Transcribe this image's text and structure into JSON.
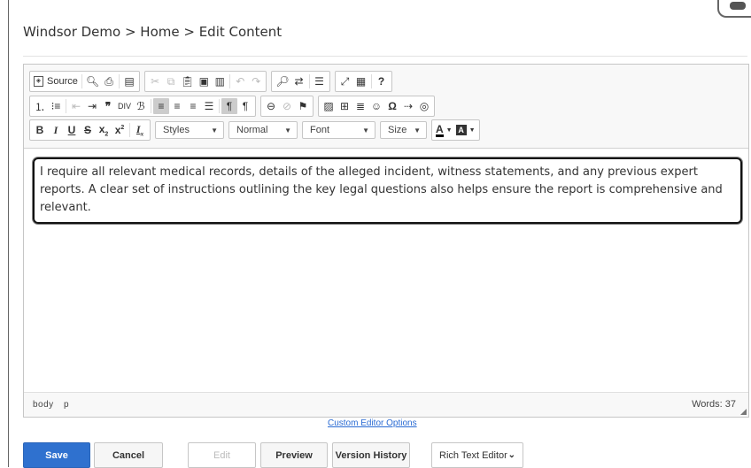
{
  "breadcrumb": "Windsor Demo > Home > Edit Content",
  "toolbar": {
    "row1": {
      "source_label": "Source",
      "icons": [
        "preview-icon",
        "print-icon",
        "templates-icon",
        "cut-icon",
        "copy-icon",
        "paste-icon",
        "paste-text-icon",
        "paste-word-icon",
        "undo-icon",
        "redo-icon",
        "find-icon",
        "replace-icon",
        "select-all-icon",
        "maximize-icon",
        "show-blocks-icon",
        "help-icon"
      ]
    },
    "row3": {
      "styles": "Styles",
      "format": "Normal",
      "font": "Font",
      "size": "Size"
    }
  },
  "content": {
    "paragraph": "I require all relevant medical records, details of the alleged incident, witness statements, and any previous expert reports. A clear set of instructions outlining the key legal questions also helps ensure the report is comprehensive and relevant."
  },
  "statusbar": {
    "path": [
      "body",
      "p"
    ],
    "words": "Words: 37"
  },
  "custom_editor_link": "Custom Editor Options",
  "actions": {
    "save": "Save",
    "cancel": "Cancel",
    "edit": "Edit",
    "preview": "Preview",
    "version_history": "Version History"
  },
  "editor_mode": {
    "selected": "Rich Text Editor"
  },
  "colors": {
    "primary_button": "#2f71cf",
    "link": "#2a6bd3",
    "active_toolbar_button": "#cccccc"
  }
}
